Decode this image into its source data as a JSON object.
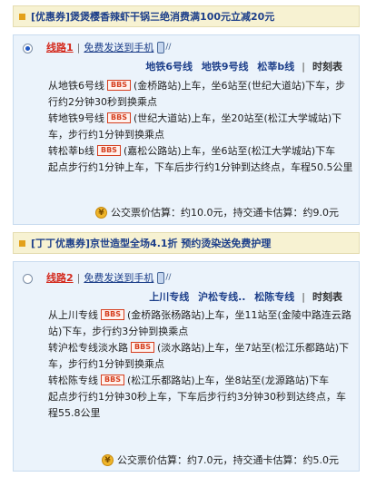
{
  "promos": [
    {
      "text": "[优惠券]煲煲樱香辣虾干锅三绝消费满100元立减20元"
    },
    {
      "text": "[丁丁优惠券]京世造型全场4.1折 预约烫染送免费护理"
    }
  ],
  "routes": [
    {
      "name": "线路1",
      "sms_label": "免费发送到手机",
      "selected": true,
      "lines": [
        "地铁6号线",
        "地铁9号线",
        "松莘b线"
      ],
      "timetable_label": "时刻表",
      "steps": [
        {
          "pre": "从地铁6号线",
          "rest": "(金桥路站)上车，坐6站至(世纪大道站)下车，步行约2分钟30秒到换乘点"
        },
        {
          "pre": "转地铁9号线",
          "rest": "(世纪大道站)上车，坐20站至(松江大学城站)下车，步行约1分钟到换乘点"
        },
        {
          "pre": "转松莘b线",
          "rest": "(嘉松公路站)上车，坐6站至(松江大学城站)下车"
        }
      ],
      "summary": "起点步行约1分钟上车，下车后步行约1分钟到达终点，车程50.5公里",
      "fare": "公交票价估算：约10.0元，持交通卡估算：约9.0元"
    },
    {
      "name": "线路2",
      "sms_label": "免费发送到手机",
      "selected": false,
      "lines": [
        "上川专线",
        "沪松专线..",
        "松陈专线"
      ],
      "timetable_label": "时刻表",
      "steps": [
        {
          "pre": "从上川专线",
          "rest": "(金桥路张杨路站)上车，坐11站至(金陵中路连云路站)下车，步行约3分钟到换乘点"
        },
        {
          "pre": "转沪松专线淡水路",
          "rest": "(淡水路站)上车，坐7站至(松江乐都路站)下车，步行约1分钟到换乘点"
        },
        {
          "pre": "转松陈专线",
          "rest": "(松江乐都路站)上车，坐8站至(龙源路站)下车"
        }
      ],
      "summary": "起点步行约1分钟30秒上车，下车后步行约3分钟30秒到达终点，车程55.8公里",
      "fare": "公交票价估算：约7.0元，持交通卡估算：约5.0元"
    }
  ],
  "badge_label": "BBS",
  "colors": {
    "accent_red": "#d42b1f",
    "link_blue": "#1d3f8a",
    "panel_bg": "#ebf3fb",
    "promo_bg": "#f7f2d2"
  }
}
